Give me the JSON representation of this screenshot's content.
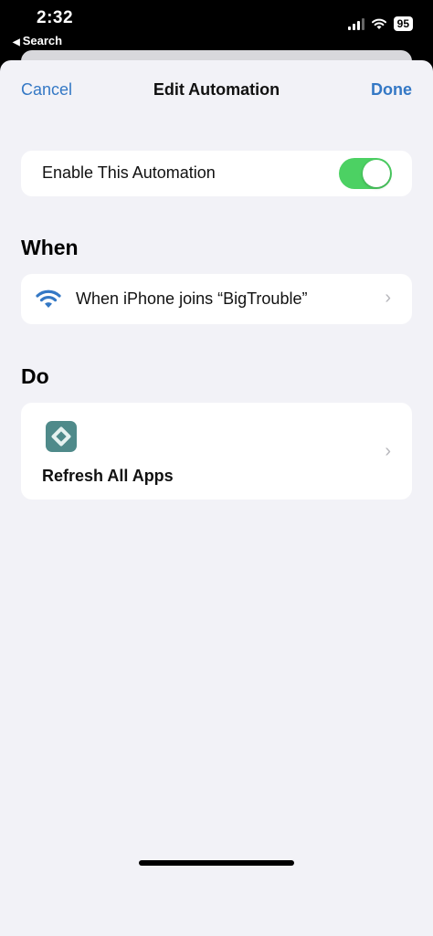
{
  "status_bar": {
    "time": "2:32",
    "back_label": "Search",
    "back_glyph": "◀",
    "battery_level": "95",
    "icons": [
      "cellular-signal-icon",
      "wifi-icon",
      "battery-icon"
    ]
  },
  "nav": {
    "cancel_label": "Cancel",
    "title": "Edit Automation",
    "done_label": "Done"
  },
  "enable": {
    "label": "Enable This Automation",
    "enabled": true
  },
  "when": {
    "header": "When",
    "trigger_label": "When iPhone joins “BigTrouble”",
    "icon": "wifi-icon"
  },
  "do": {
    "header": "Do",
    "action_label": "Refresh All Apps",
    "icon": "app-icon"
  },
  "colors": {
    "accent": "#3478c5",
    "toggle_on": "#4cd163",
    "background": "#f2f2f7",
    "app_icon": "#4f8a8a"
  },
  "glyphs": {
    "chevron": "›"
  }
}
